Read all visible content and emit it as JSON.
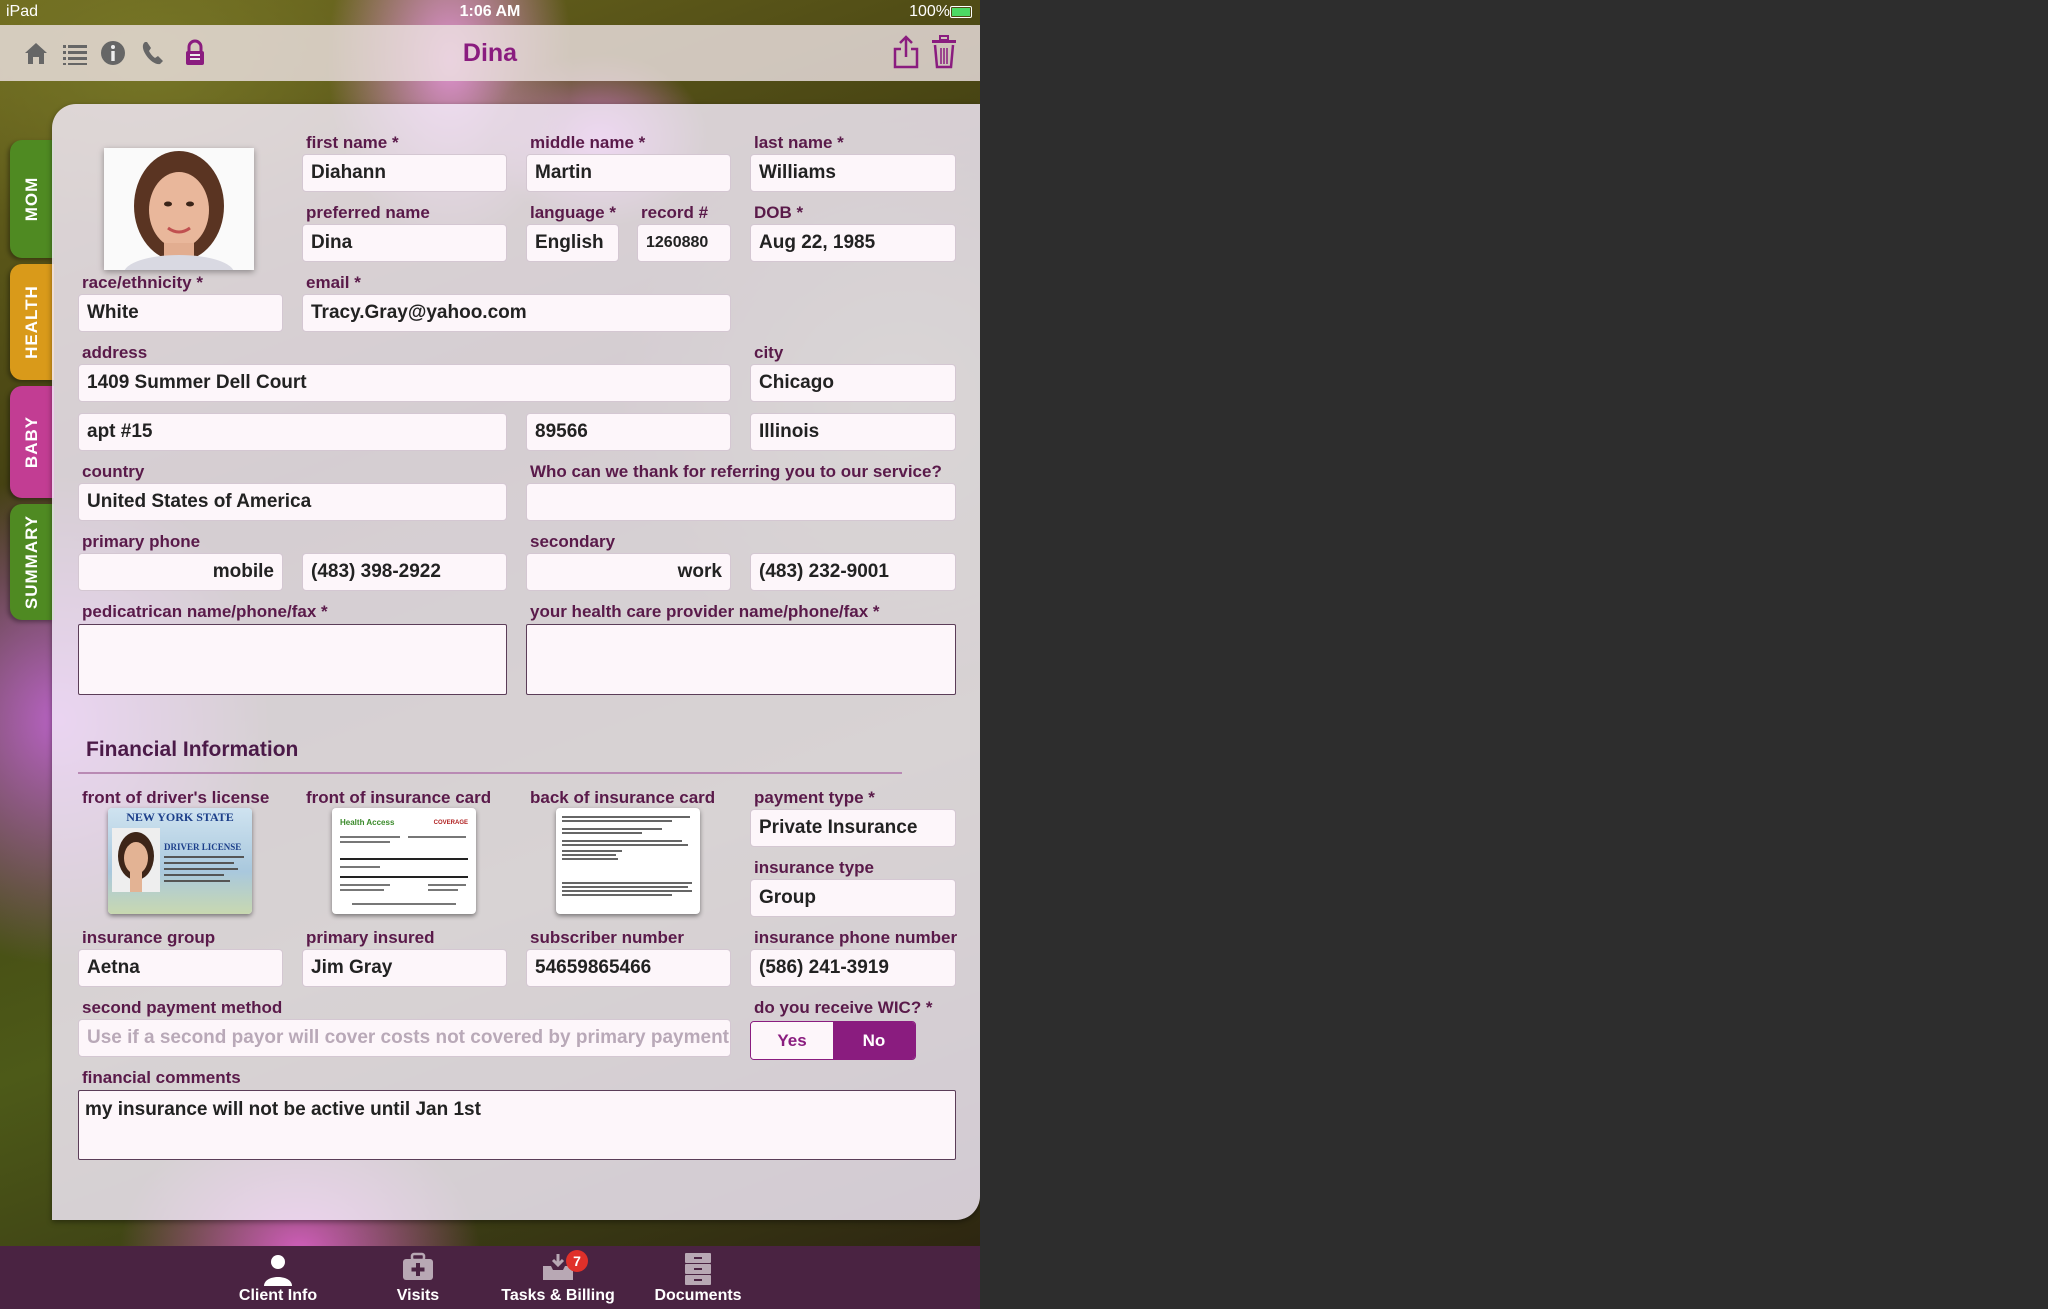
{
  "status_bar": {
    "device": "iPad",
    "time": "1:06 AM",
    "battery": "100%"
  },
  "nav": {
    "title": "Dina",
    "left_icons": [
      "home-icon",
      "list-icon",
      "info-icon",
      "phone-icon",
      "lock-icon"
    ],
    "right_icons": [
      "share-icon",
      "trash-icon"
    ]
  },
  "side_tabs": [
    {
      "label": "MOM",
      "color": "#4f8a22"
    },
    {
      "label": "HEALTH",
      "color": "#d99a1a"
    },
    {
      "label": "BABY",
      "color": "#c23d93"
    },
    {
      "label": "SUMMARY",
      "color": "#4f8a22"
    }
  ],
  "form": {
    "first_name": {
      "label": "first name *",
      "value": "Diahann"
    },
    "middle_name": {
      "label": "middle name *",
      "value": "Martin"
    },
    "last_name": {
      "label": "last name *",
      "value": "Williams"
    },
    "preferred_name": {
      "label": "preferred name",
      "value": "Dina"
    },
    "language": {
      "label": "language *",
      "value": "English"
    },
    "record": {
      "label": "record #",
      "value": "1260880"
    },
    "dob": {
      "label": "DOB *",
      "value": "Aug 22, 1985"
    },
    "race": {
      "label": "race/ethnicity *",
      "value": "White"
    },
    "email": {
      "label": "email *",
      "value": "Tracy.Gray@yahoo.com"
    },
    "address": {
      "label": "address",
      "value": "1409 Summer Dell Court"
    },
    "city": {
      "label": "city",
      "value": "Chicago"
    },
    "apt": {
      "value": "apt #15"
    },
    "zip": {
      "value": "89566"
    },
    "state": {
      "value": "Illinois"
    },
    "country": {
      "label": "country",
      "value": "United States of America"
    },
    "referral": {
      "label": "Who can we thank for referring you to our service?",
      "value": ""
    },
    "primary_phone": {
      "label": "primary phone",
      "type": "mobile",
      "value": "(483) 398-2922"
    },
    "secondary_phone": {
      "label": "secondary",
      "type": "work",
      "value": "(483) 232-9001"
    },
    "pediatrician": {
      "label": "pedicatrican name/phone/fax *",
      "value": ""
    },
    "provider": {
      "label": "your health care provider name/phone/fax *",
      "value": ""
    }
  },
  "financial": {
    "title": "Financial Information",
    "drivers_license": {
      "label": "front of driver's license",
      "state": "NEW YORK STATE",
      "doc": "DRIVER LICENSE"
    },
    "insurance_front": {
      "label": "front of insurance card",
      "brand": "Health Access",
      "tag": "COVERAGE"
    },
    "insurance_back": {
      "label": "back of insurance card"
    },
    "payment_type": {
      "label": "payment type *",
      "value": "Private Insurance"
    },
    "insurance_type": {
      "label": "insurance type",
      "value": "Group"
    },
    "insurance_group": {
      "label": "insurance group",
      "value": "Aetna"
    },
    "primary_insured": {
      "label": "primary insured",
      "value": "Jim Gray"
    },
    "subscriber_number": {
      "label": "subscriber number",
      "value": "54659865466"
    },
    "insurance_phone": {
      "label": "insurance phone number",
      "value": "(586) 241-3919"
    },
    "second_payment": {
      "label": "second payment method",
      "placeholder": "Use if a second payor will cover costs not covered by primary payment..."
    },
    "wic": {
      "label": "do you receive WIC? *",
      "yes": "Yes",
      "no": "No",
      "selected": "No"
    },
    "comments": {
      "label": "financial comments",
      "value": "my insurance will not be active until Jan 1st"
    }
  },
  "tab_bar": {
    "tabs": [
      {
        "label": "Client Info",
        "icon": "person-icon"
      },
      {
        "label": "Visits",
        "icon": "medical-bag-icon"
      },
      {
        "label": "Tasks & Billing",
        "icon": "inbox-icon",
        "badge": "7"
      },
      {
        "label": "Documents",
        "icon": "file-cabinet-icon"
      }
    ]
  },
  "colors": {
    "accent": "#8a1c7f",
    "label": "#5a1a4a",
    "tab_bar": "#4a2342"
  }
}
